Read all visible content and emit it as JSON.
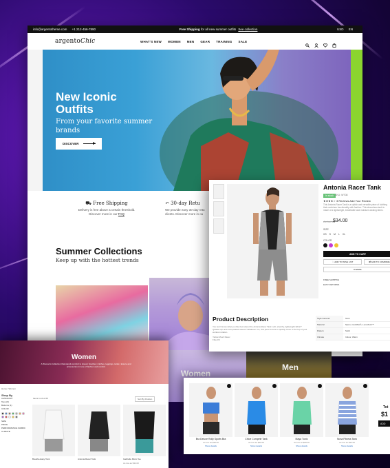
{
  "topbar": {
    "email": "info@argentotheme.com",
    "phone": "+1 212-456-7890",
    "promo_bold": "Free Shipping",
    "promo_text": "for all new summer outfits",
    "promo_link": "See collection",
    "currency": "USD",
    "language": "EN"
  },
  "nav": {
    "logo_main": "argento",
    "logo_script": "Chic",
    "menu": [
      "WHAT'S NEW",
      "WOMEN",
      "MEN",
      "GEAR",
      "TRAINING",
      "SALE"
    ],
    "icons": [
      "search-icon",
      "user-icon",
      "heart-icon",
      "cart-icon"
    ]
  },
  "hero": {
    "title_line1": "New Iconic",
    "title_line2": "Outfits",
    "subtitle": "From your favorite summer brands",
    "button": "DISCOVER"
  },
  "features": [
    {
      "title": "Free Shipping",
      "line1": "Delivery is free above a certain threshold.",
      "line2": "Discover more in our",
      "link": "FAQ"
    },
    {
      "title": "30-day Retu",
      "line1": "We provide easy 30-day retu",
      "line2": "clients. Discover more in ou",
      "link": ""
    }
  ],
  "collections": {
    "title": "Summer Collections",
    "subtitle": "Keep up with the hottest trends",
    "women_label": "Women",
    "men_label": "Men"
  },
  "product": {
    "title": "Antonia Racer Tank",
    "stock": "In stock",
    "sku": "SKU: WT08",
    "rating_text": "★★★★☆ 3 Reviews  Add Your Review",
    "short_desc": "This Antonia Racer Tank is a stylish and versatile piece of clothing that combines functionality with fashion. This sleeveless tank is made of a lightweight, breathable and moisture-wicking fabric.",
    "old_price": "As low as",
    "price": "$34.00",
    "size_label": "SIZE",
    "sizes": [
      "XS",
      "S",
      "M",
      "L",
      "XL"
    ],
    "color_label": "COLOR",
    "colors": [
      "#111111",
      "#c43ad3",
      "#f1c232"
    ],
    "add_to_cart": "ADD TO CART",
    "wishlist": "ADD TO WISH LIST",
    "compare": "ADD TO COMPARE",
    "email": "EMAIL",
    "shipping_lines": [
      "FREE SHIPPING",
      "EASY RETURNS"
    ],
    "desc_title": "Product Description",
    "desc_text": "You won't know what you like best about the Antonia Racer Tank: soft, stretchy, lightweight fabric? Quarter-zip and incorporated sleeve? Whatever it is, this piece is sure to quickly move to the top of your workout rotation.",
    "desc_bullets": [
      "Yellow Mesh Racer",
      "Fitted fit"
    ],
    "specs": [
      [
        "Style General",
        "Tank"
      ],
      [
        "Material",
        "Nylon, CoolMax®, LumaTech™"
      ],
      [
        "Pattern",
        "Solid"
      ],
      [
        "Climate",
        "Indoor, Warm"
      ]
    ]
  },
  "category": {
    "title": "Women",
    "text": "A Woman's Collection that stands comfort to dress | Soothes | clothes, leggings, tanks | leisure and accessories in tune of fashion and comfort",
    "crumb": "Home  /  Women",
    "side_title": "Shop By",
    "side_items": [
      "CATEGORY",
      "Tops (6)",
      "Bottoms (1)",
      "COLOR",
      "SIZE",
      "PRICE",
      "PERFORMANCE FABRIC",
      "CLIMATE"
    ],
    "swatch_colors": [
      "#111",
      "#2b6fc4",
      "#8b5a2b",
      "#2ba84a",
      "#9c9c9c",
      "#f39c34",
      "#ec5ca3",
      "#9b3fc4",
      "#d62e2e",
      "#fff",
      "#f1c232",
      "#555"
    ],
    "toolbar": "Items 1-12 of 25",
    "sort": "Sort By  Position",
    "products": [
      "Breathe-Easy Tank",
      "Antonia Racer Tank",
      "Gabrielle Micro Tee"
    ],
    "product_price": "As low as $34.00"
  },
  "related": {
    "items": [
      {
        "name": "Bra Deluxe Rolly Sports Bra",
        "price": "As low as $38.00"
      },
      {
        "name": "Chloe Compete Tank",
        "price": "As low as $39.00"
      },
      {
        "name": "Maya Tunic",
        "price": "As low as $28.00"
      },
      {
        "name": "Nona Fitness Tank",
        "price": "As low as $33.00"
      }
    ],
    "details_link": "Show details",
    "total_label": "Tot",
    "total_value": "$1",
    "add_label": "ADD"
  }
}
